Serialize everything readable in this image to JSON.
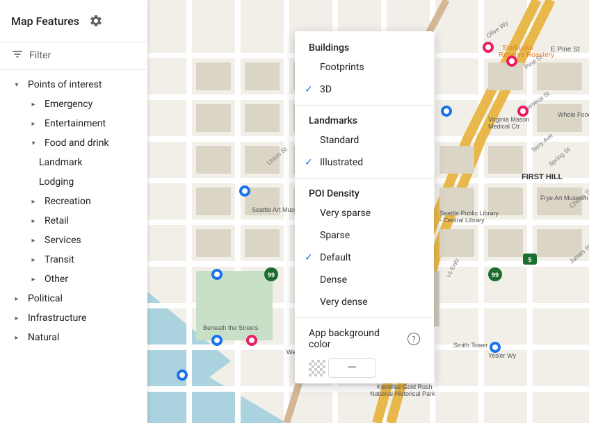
{
  "header": {
    "title": "Map Features",
    "gear_icon": "⚙"
  },
  "filter": {
    "label": "Filter",
    "icon": "≡"
  },
  "sidebar": {
    "items": [
      {
        "label": "Points of interest",
        "level": 0,
        "has_chevron": true,
        "chevron": "▾"
      },
      {
        "label": "Emergency",
        "level": 1,
        "has_chevron": true,
        "chevron": "▸"
      },
      {
        "label": "Entertainment",
        "level": 1,
        "has_chevron": true,
        "chevron": "▸"
      },
      {
        "label": "Food and drink",
        "level": 1,
        "has_chevron": true,
        "chevron": "▸"
      },
      {
        "label": "Landmark",
        "level": 2
      },
      {
        "label": "Lodging",
        "level": 2
      },
      {
        "label": "Recreation",
        "level": 1,
        "has_chevron": true,
        "chevron": "▸"
      },
      {
        "label": "Retail",
        "level": 1,
        "has_chevron": true,
        "chevron": "▸"
      },
      {
        "label": "Services",
        "level": 1,
        "has_chevron": true,
        "chevron": "▸"
      },
      {
        "label": "Transit",
        "level": 1,
        "has_chevron": true,
        "chevron": "▸"
      },
      {
        "label": "Other",
        "level": 1,
        "has_chevron": true,
        "chevron": "▸"
      },
      {
        "label": "Political",
        "level": 0,
        "has_chevron": true,
        "chevron": "▸"
      },
      {
        "label": "Infrastructure",
        "level": 0,
        "has_chevron": true,
        "chevron": "▸"
      },
      {
        "label": "Natural",
        "level": 0,
        "has_chevron": true,
        "chevron": "▸"
      }
    ]
  },
  "dropdown": {
    "buildings": {
      "section_title": "Buildings",
      "items": [
        {
          "label": "Footprints",
          "checked": false
        },
        {
          "label": "3D",
          "checked": true
        }
      ]
    },
    "landmarks": {
      "section_title": "Landmarks",
      "items": [
        {
          "label": "Standard",
          "checked": false
        },
        {
          "label": "Illustrated",
          "checked": true
        }
      ]
    },
    "poi_density": {
      "section_title": "POI Density",
      "items": [
        {
          "label": "Very sparse",
          "checked": false
        },
        {
          "label": "Sparse",
          "checked": false
        },
        {
          "label": "Default",
          "checked": true
        },
        {
          "label": "Dense",
          "checked": false
        },
        {
          "label": "Very dense",
          "checked": false
        }
      ]
    },
    "bg_color": {
      "label": "App background color",
      "help_icon": "?",
      "dash": "—"
    }
  },
  "check_mark": "✓"
}
